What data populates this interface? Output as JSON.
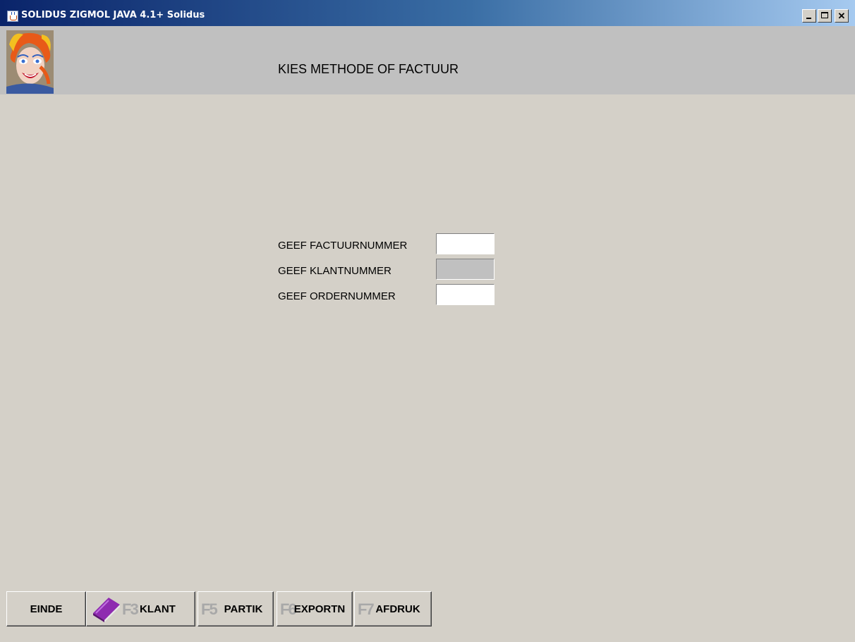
{
  "window": {
    "title": "SOLIDUS ZIGMOL JAVA 4.1+ Solidus",
    "controls": {
      "minimize": "_",
      "maximize": "□",
      "close": "✕"
    }
  },
  "header": {
    "title": "KIES METHODE OF FACTUUR"
  },
  "form": {
    "invoice_label": "GEEF FACTUURNUMMER",
    "invoice_value": "",
    "customer_label": "GEEF KLANTNUMMER",
    "customer_value": "",
    "order_label": "GEEF ORDERNUMMER",
    "order_value": ""
  },
  "buttons": {
    "einde": "EINDE",
    "klant": "KLANT",
    "klant_key": "F3",
    "partik": "PARTIK",
    "partik_key": "F5",
    "exportn": "EXPORTN",
    "exportn_key": "F6",
    "afdruk": "AFDRUK",
    "afdruk_key": "F7"
  },
  "icons": {
    "app": "java-cup-icon",
    "book": "book-icon",
    "colors": {
      "book": "#8e2bb0",
      "title_bar_start": "#0a246a",
      "title_bar_end": "#a6caf0"
    }
  }
}
